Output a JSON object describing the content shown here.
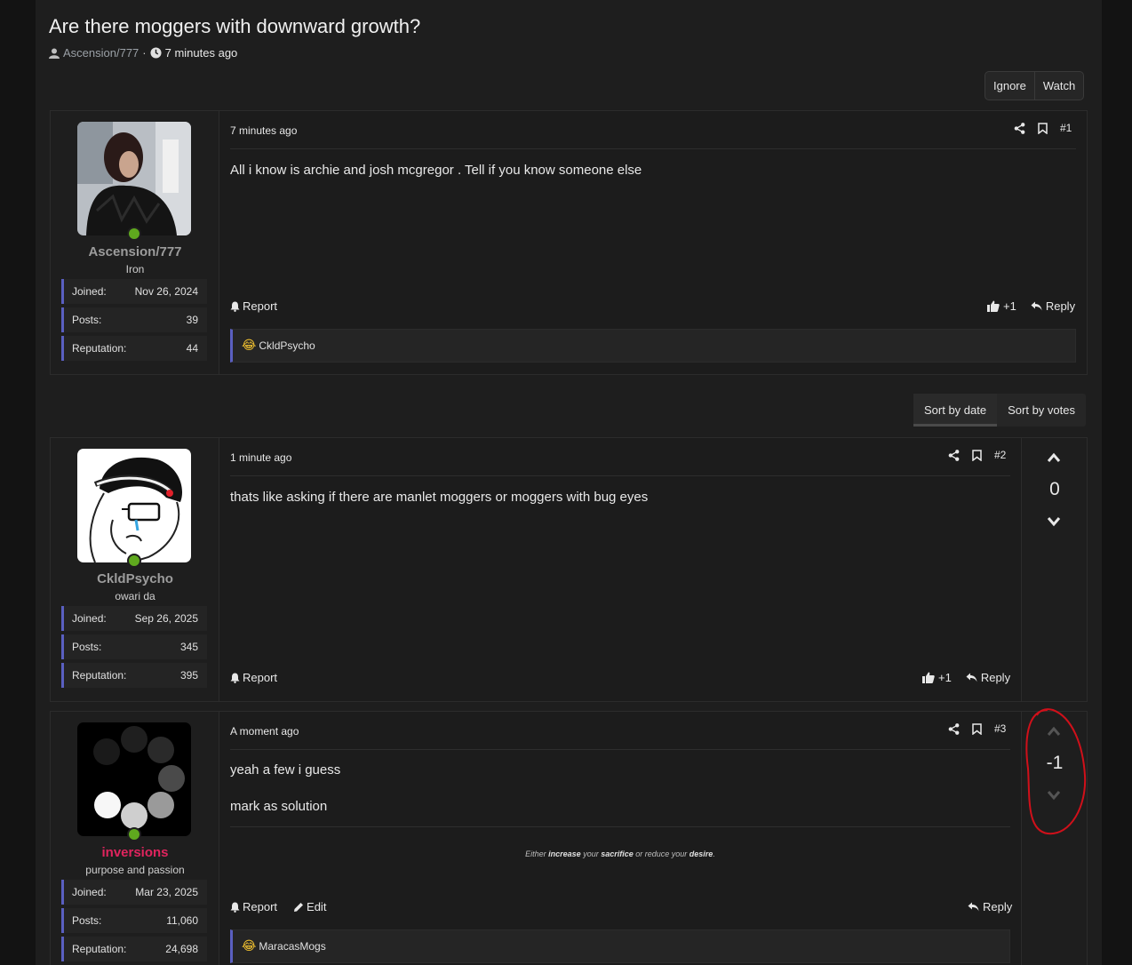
{
  "thread": {
    "title": "Are there moggers with downward growth?",
    "author": "Ascension/777",
    "separator": "·",
    "ago": "7 minutes ago"
  },
  "thread_buttons": {
    "ignore": "Ignore",
    "watch": "Watch"
  },
  "sort": {
    "by_date": "Sort by date",
    "by_votes": "Sort by votes"
  },
  "labels": {
    "joined": "Joined:",
    "posts": "Posts:",
    "reputation": "Reputation:",
    "report": "Report",
    "reply": "Reply",
    "edit": "Edit"
  },
  "posts": [
    {
      "number": "#1",
      "date": "7 minutes ago",
      "body": [
        "All i know is archie and josh mcgregor . Tell if you know someone else"
      ],
      "user": {
        "name": "Ascension/777",
        "title": "Iron",
        "joined": "Nov 26, 2024",
        "posts": "39",
        "reputation": "44"
      },
      "likes": "+1",
      "reaction_user": "CkldPsycho"
    },
    {
      "number": "#2",
      "date": "1 minute ago",
      "body": [
        "thats like asking if there are manlet moggers or moggers with bug eyes"
      ],
      "user": {
        "name": "CkldPsycho",
        "title": "owari da",
        "joined": "Sep 26, 2025",
        "posts": "345",
        "reputation": "395"
      },
      "likes": "+1",
      "votes": "0"
    },
    {
      "number": "#3",
      "date": "A moment ago",
      "body": [
        "yeah a few i guess",
        "mark as solution"
      ],
      "user": {
        "name": "inversions",
        "title": "purpose and passion",
        "joined": "Mar 23, 2025",
        "posts": "11,060",
        "reputation": "24,698"
      },
      "votes": "-1",
      "signature": {
        "p1": "Either ",
        "b1": "increase",
        "p2": " your ",
        "b2": "sacrifice",
        "p3": " or ",
        "b3": "reduce",
        "p4": " your ",
        "b4": "desire",
        "p5": "."
      },
      "reaction_user": "MaracasMogs"
    }
  ],
  "colors": {
    "accent": "#5a5fc0",
    "online": "#5fa91e",
    "username_special": "#e0245e",
    "annotation": "#d0101a"
  }
}
